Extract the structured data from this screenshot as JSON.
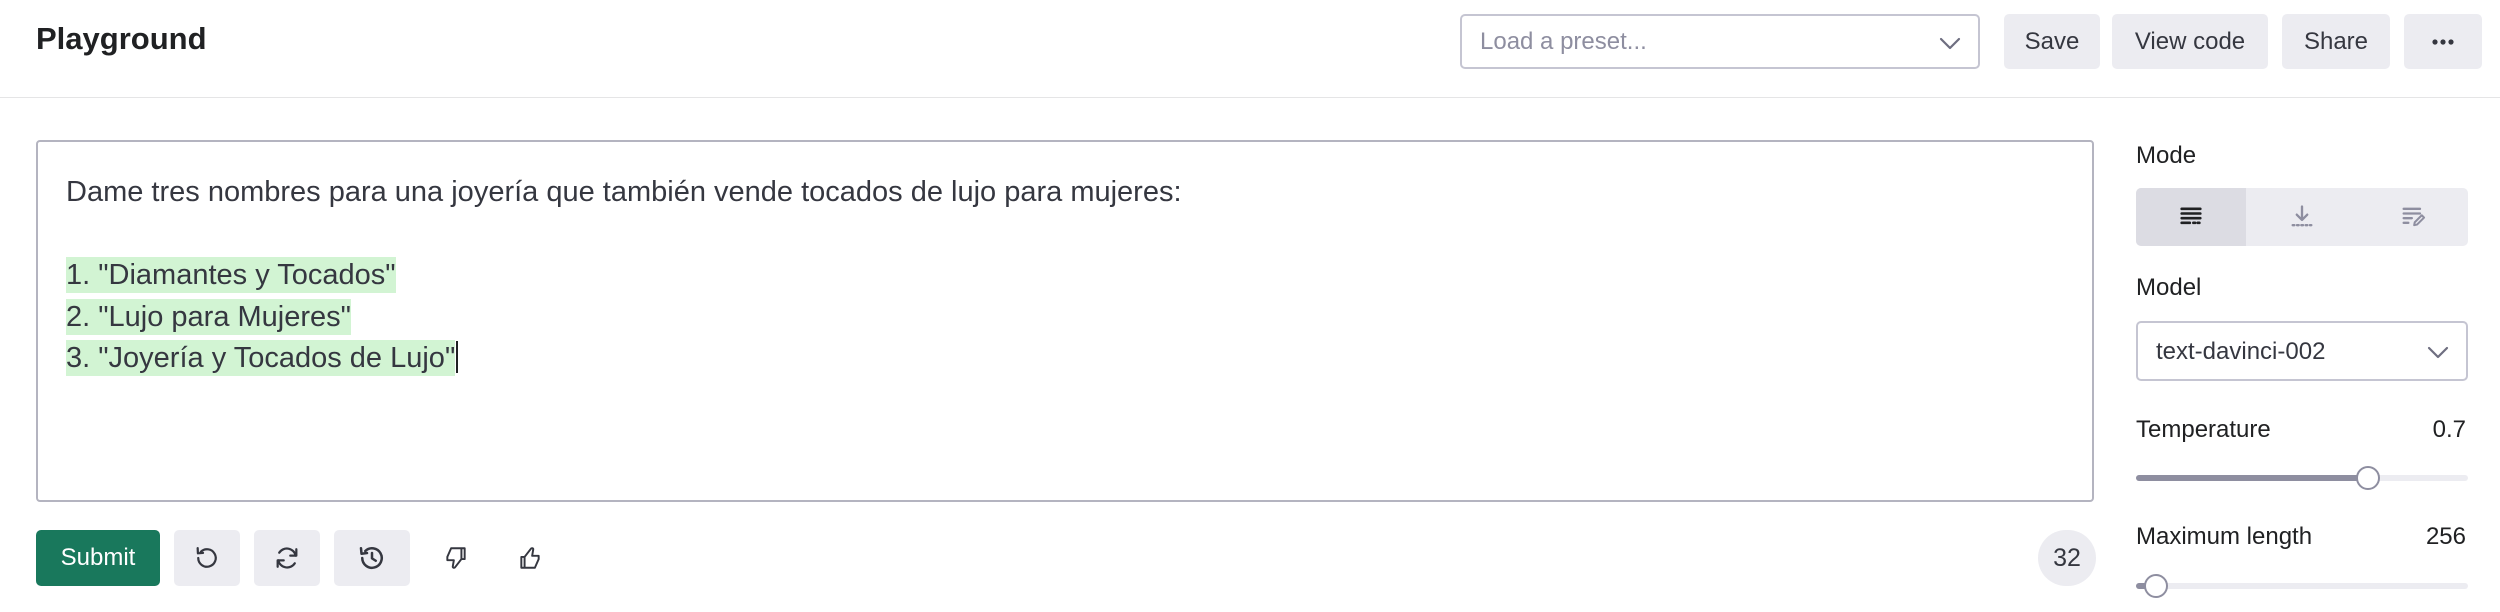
{
  "header": {
    "title": "Playground",
    "preset_placeholder": "Load a preset...",
    "save_label": "Save",
    "view_code_label": "View code",
    "share_label": "Share",
    "more_icon": "ellipsis-icon"
  },
  "editor": {
    "prompt_line": "Dame tres nombres para una joyería que también vende tocados de lujo para mujeres:",
    "completion_lines": [
      "1. \"Diamantes y Tocados\"",
      "2. \"Lujo para Mujeres\"",
      "3. \"Joyería y Tocados de Lujo\""
    ],
    "highlight_color": "#d2f4d3"
  },
  "toolbar": {
    "submit_label": "Submit",
    "submit_color": "#19785c",
    "token_count": "32",
    "icons": [
      "undo-icon",
      "regenerate-icon",
      "history-icon",
      "thumbs-down-icon",
      "thumbs-up-icon"
    ]
  },
  "settings": {
    "mode_label": "Mode",
    "mode_options": [
      "complete-mode-icon",
      "insert-mode-icon",
      "edit-mode-icon"
    ],
    "mode_selected": 0,
    "model_label": "Model",
    "model_value": "text-davinci-002",
    "temperature_label": "Temperature",
    "temperature_value": "0.7",
    "temperature_fraction": 0.7,
    "max_length_label": "Maximum length",
    "max_length_value": "256",
    "max_length_fraction": 0.06
  }
}
